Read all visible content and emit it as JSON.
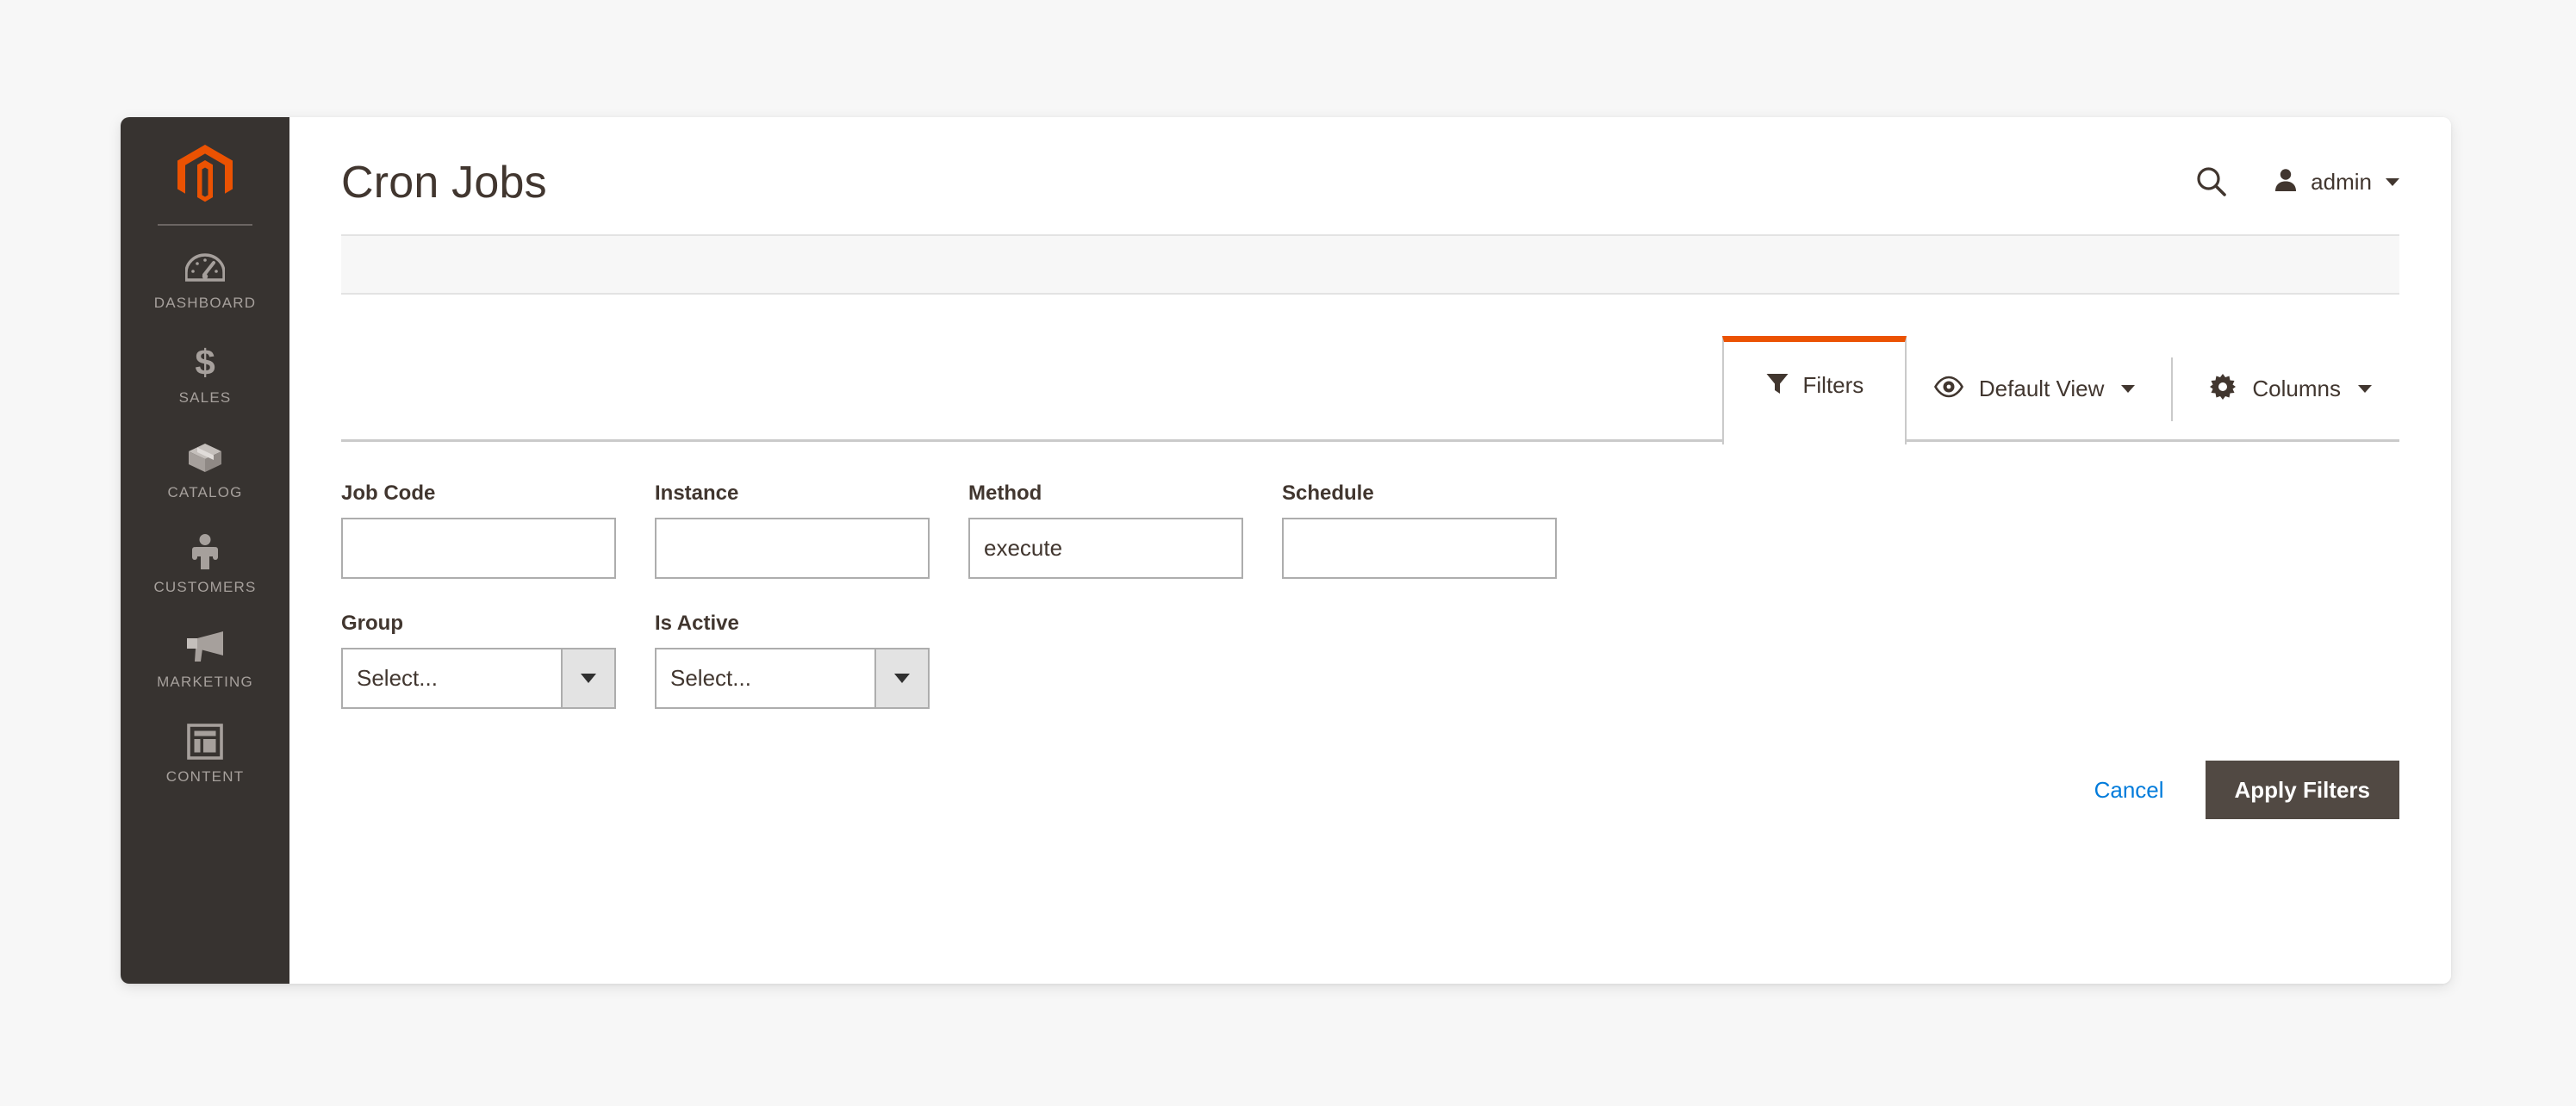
{
  "colors": {
    "accent_orange": "#eb5202",
    "sidebar_bg": "#373330",
    "button_dark": "#514943",
    "link_blue": "#007bdb",
    "text_dark": "#41362f"
  },
  "sidebar": {
    "logo_icon": "magento-logo-icon",
    "items": [
      {
        "label": "Dashboard",
        "icon": "dashboard-gauge-icon"
      },
      {
        "label": "Sales",
        "icon": "dollar-sign-icon"
      },
      {
        "label": "Catalog",
        "icon": "box-package-icon"
      },
      {
        "label": "Customers",
        "icon": "person-icon"
      },
      {
        "label": "Marketing",
        "icon": "megaphone-icon"
      },
      {
        "label": "Content",
        "icon": "layout-page-icon"
      }
    ]
  },
  "header": {
    "title": "Cron Jobs",
    "search_icon": "search-icon",
    "user_icon": "user-avatar-icon",
    "admin_name": "admin",
    "caret_icon": "chevron-down-icon"
  },
  "toolbar": {
    "filters_tab": {
      "label": "Filters",
      "icon": "funnel-filter-icon",
      "active": true
    },
    "view_button": {
      "label": "Default View",
      "icon": "eye-view-icon",
      "caret": "chevron-down-icon"
    },
    "columns_button": {
      "label": "Columns",
      "icon": "gear-settings-icon",
      "caret": "chevron-down-icon"
    }
  },
  "filters": {
    "row1": [
      {
        "label": "Job Code",
        "type": "text",
        "value": "",
        "placeholder": ""
      },
      {
        "label": "Instance",
        "type": "text",
        "value": "",
        "placeholder": ""
      },
      {
        "label": "Method",
        "type": "text",
        "value": "execute",
        "placeholder": ""
      },
      {
        "label": "Schedule",
        "type": "text",
        "value": "",
        "placeholder": ""
      }
    ],
    "row2": [
      {
        "label": "Group",
        "type": "select",
        "value": "Select..."
      },
      {
        "label": "Is Active",
        "type": "select",
        "value": "Select..."
      }
    ]
  },
  "actions": {
    "cancel_label": "Cancel",
    "apply_label": "Apply Filters"
  }
}
